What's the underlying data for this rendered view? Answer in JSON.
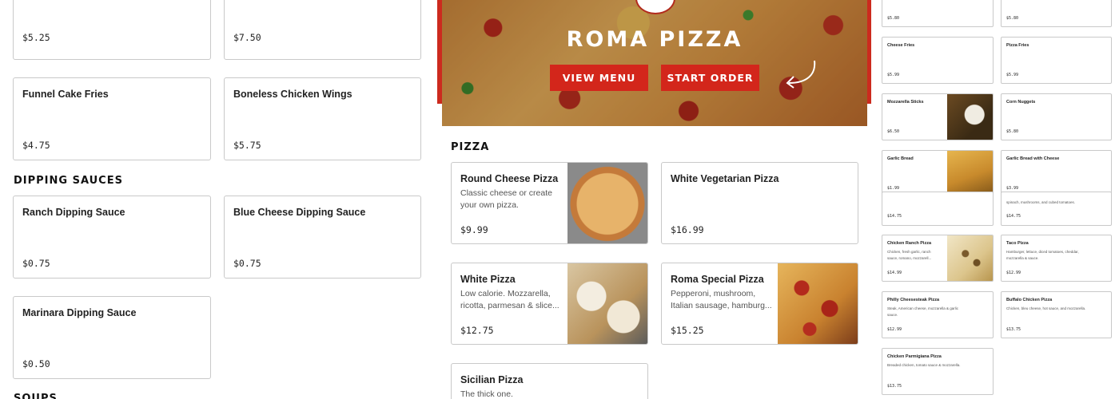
{
  "left_column": {
    "top_cards": [
      {
        "price": "$5.25"
      },
      {
        "price": "$7.50"
      }
    ],
    "cards_row2": [
      {
        "name": "Funnel Cake Fries",
        "price": "$4.75"
      },
      {
        "name": "Boneless Chicken Wings",
        "price": "$5.75"
      }
    ],
    "dipping_title": "DIPPING SAUCES",
    "sauces": [
      {
        "name": "Ranch Dipping Sauce",
        "price": "$0.75"
      },
      {
        "name": "Blue Cheese Dipping Sauce",
        "price": "$0.75"
      },
      {
        "name": "Marinara Dipping Sauce",
        "price": "$0.50"
      }
    ],
    "soups_title": "SOUPS"
  },
  "hero": {
    "title": "ROMA PIZZA",
    "view_menu": "VIEW MENU",
    "start_order": "START ORDER"
  },
  "pizza_section": {
    "title": "PIZZA",
    "items": [
      {
        "name": "Round Cheese Pizza",
        "desc1": "Classic cheese or create",
        "desc2": "your own pizza.",
        "price": "$9.99"
      },
      {
        "name": "White Vegetarian Pizza",
        "price": "$16.99"
      },
      {
        "name": "White Pizza",
        "desc1": "Low calorie. Mozzarella,",
        "desc2": "ricotta, parmesan & slice...",
        "price": "$12.75"
      },
      {
        "name": "Roma Special Pizza",
        "desc1": "Pepperoni, mushroom,",
        "desc2": "Italian sausage, hamburg...",
        "price": "$15.25"
      },
      {
        "name": "Sicilian Pizza",
        "desc1": "The thick one."
      }
    ]
  },
  "right_column": {
    "items": [
      {
        "price": "$5.80"
      },
      {
        "price": "$5.80"
      },
      {
        "name": "Cheese Fries",
        "price": "$5.99"
      },
      {
        "name": "Pizza Fries",
        "price": "$5.99"
      },
      {
        "name": "Mozzarella Sticks",
        "price": "$6.50"
      },
      {
        "name": "Corn Nuggets",
        "price": "$5.80"
      },
      {
        "name": "Garlic Bread",
        "price": "$1.99"
      },
      {
        "name": "Garlic Bread with Cheese",
        "price": "$3.99"
      },
      {
        "price": "$14.75"
      },
      {
        "desc": "spinach, mushrooms, and cubed tomatoes.",
        "price": "$14.75"
      },
      {
        "name": "Chicken Ranch Pizza",
        "desc1": "Chicken, fresh garlic, ranch",
        "desc2": "sauce, romano, mozzarell...",
        "price": "$14.99"
      },
      {
        "name": "Taco Pizza",
        "desc1": "Hamburger, lettuce, diced tomatoes, cheddar,",
        "desc2": "mozzarella & sauce.",
        "price": "$12.99"
      },
      {
        "name": "Philly Cheesesteak Pizza",
        "desc1": "Steak, American cheese, mozzarella & garlic",
        "desc2": "sauce.",
        "price": "$12.99"
      },
      {
        "name": "Buffalo Chicken Pizza",
        "desc1": "Chicken, bleu cheese, hot sauce, and mozzarella.",
        "price": "$13.75"
      },
      {
        "name": "Chicken Parmigiana Pizza",
        "desc1": "Breaded chicken, tomato sauce & mozzarella.",
        "price": "$13.75"
      }
    ]
  },
  "colors": {
    "accent_red": "#d3261b",
    "border": "#c9c9c9"
  }
}
